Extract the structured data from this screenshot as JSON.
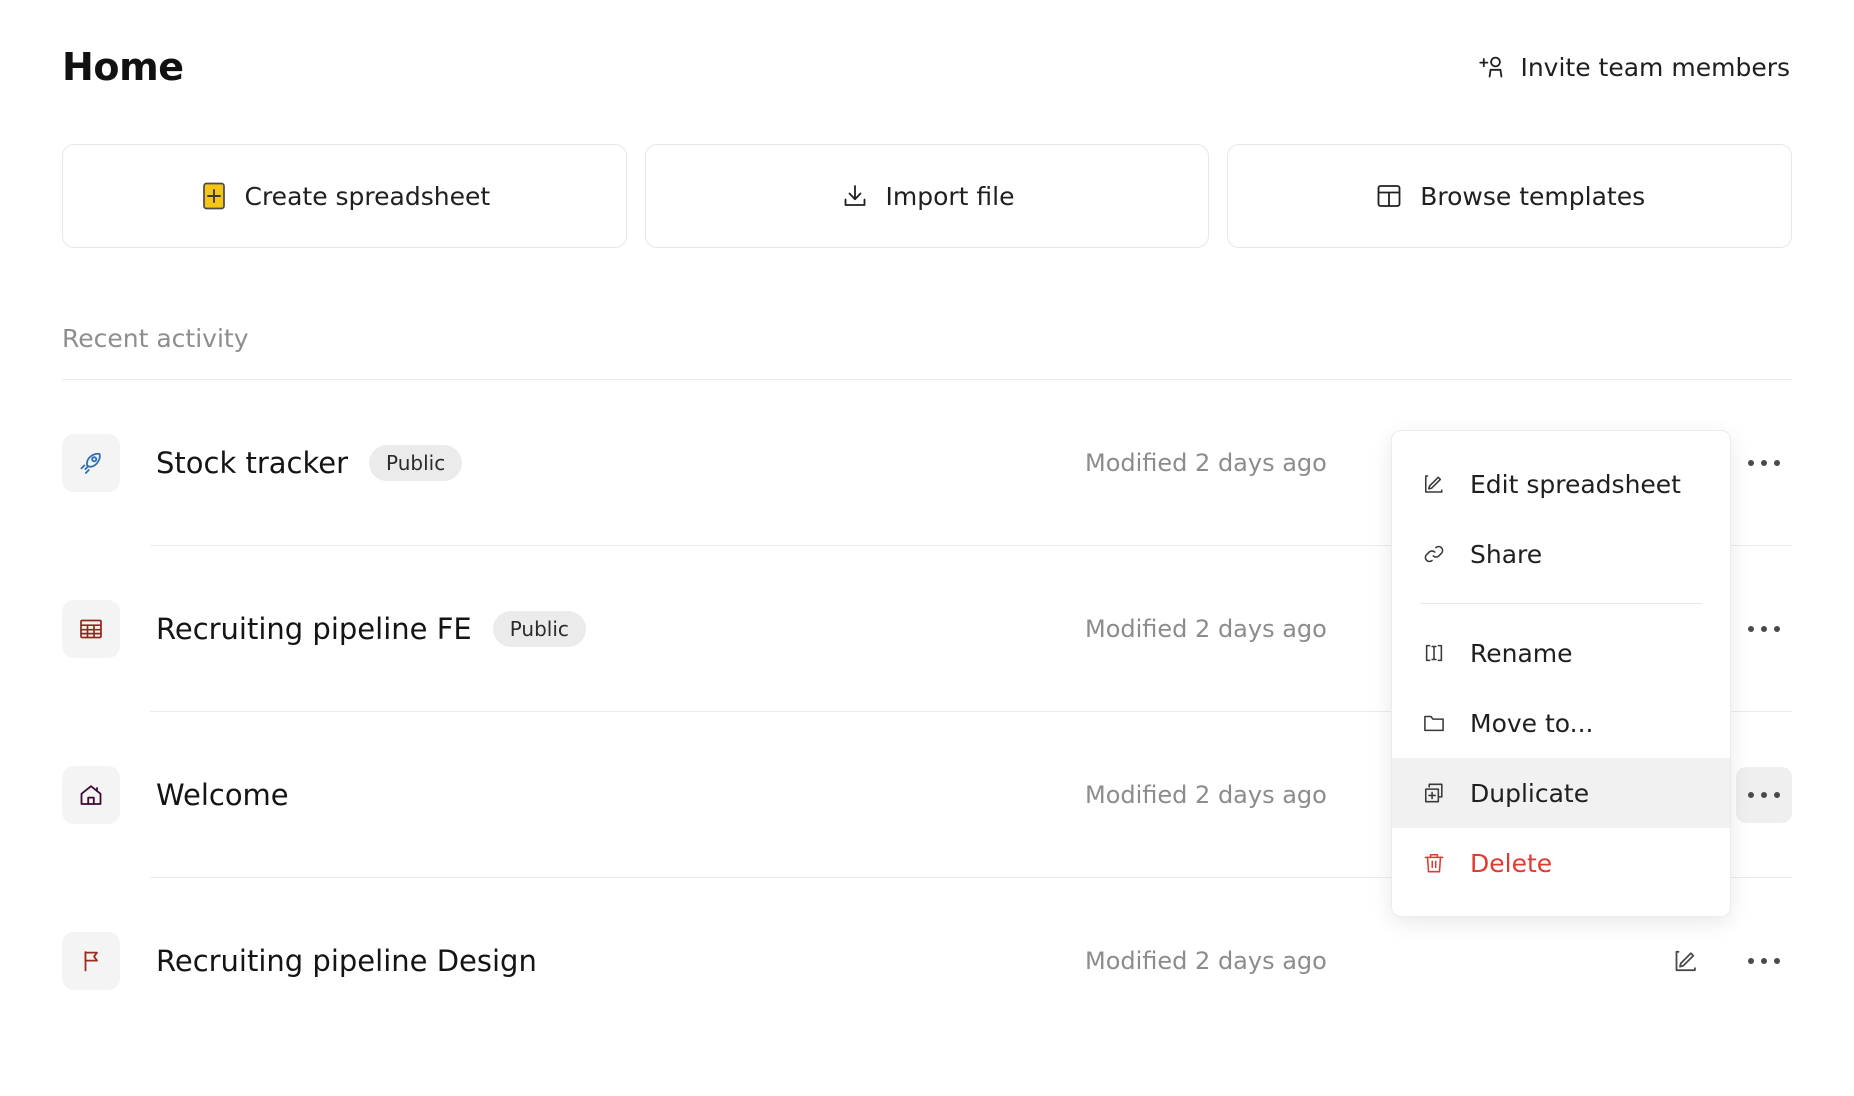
{
  "header": {
    "title": "Home",
    "invite_label": "Invite team members",
    "invite_icon": "person-plus-icon"
  },
  "actions": [
    {
      "label": "Create spreadsheet",
      "icon": "plus-square-yellow-icon",
      "accent": "#f5c518"
    },
    {
      "label": "Import file",
      "icon": "import-download-icon"
    },
    {
      "label": "Browse templates",
      "icon": "template-layout-icon"
    }
  ],
  "recent": {
    "section_label": "Recent activity",
    "rows": [
      {
        "name": "Stock tracker",
        "badge": "Public",
        "modified": "Modified 2 days ago",
        "icon": "rocket-icon",
        "icon_color": "#2f6fb5",
        "menu_active": false,
        "has_edit_icon": false
      },
      {
        "name": "Recruiting pipeline FE",
        "badge": "Public",
        "modified": "Modified 2 days ago",
        "icon": "table-grid-icon",
        "icon_color": "#8e2a1c",
        "menu_active": false,
        "has_edit_icon": false
      },
      {
        "name": "Welcome",
        "badge": "",
        "modified": "Modified 2 days ago",
        "icon": "house-icon",
        "icon_color": "#3d0a33",
        "menu_active": true,
        "has_edit_icon": false
      },
      {
        "name": "Recruiting pipeline Design",
        "badge": "",
        "modified": "Modified 2 days ago",
        "icon": "flag-icon",
        "icon_color": "#9b2c20",
        "menu_active": false,
        "has_edit_icon": true
      }
    ]
  },
  "context_menu": {
    "items": [
      {
        "label": "Edit spreadsheet",
        "icon": "edit-pencil-icon",
        "state": "normal"
      },
      {
        "label": "Share",
        "icon": "link-chain-icon",
        "state": "normal"
      },
      {
        "label": "Rename",
        "icon": "text-cursor-icon",
        "state": "normal"
      },
      {
        "label": "Move to...",
        "icon": "folder-icon",
        "state": "normal"
      },
      {
        "label": "Duplicate",
        "icon": "duplicate-copy-icon",
        "state": "highlighted"
      },
      {
        "label": "Delete",
        "icon": "trash-icon",
        "state": "danger"
      }
    ],
    "danger_color": "#e03a33"
  }
}
